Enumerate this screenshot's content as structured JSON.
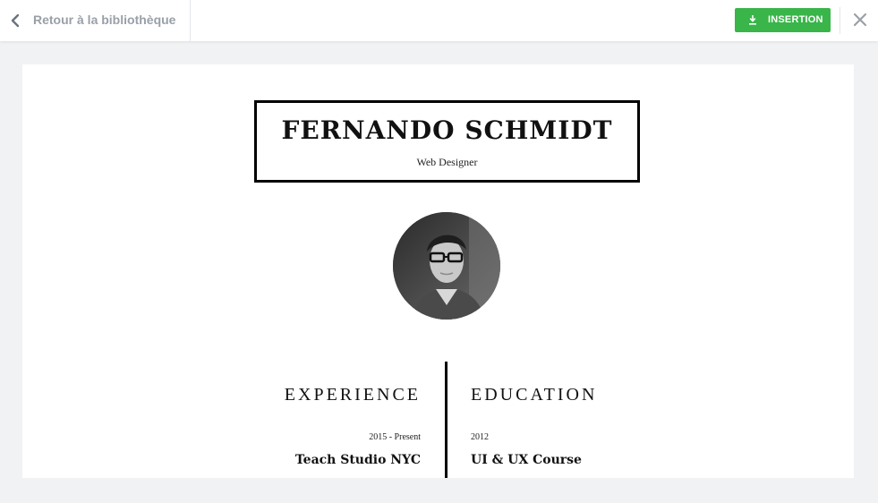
{
  "topbar": {
    "back_label": "Retour à la bibliothèque",
    "insert_label": "INSERTION",
    "accent_color": "#39b54a",
    "icons": [
      "chevron-left-icon",
      "download-icon",
      "close-icon"
    ]
  },
  "resume": {
    "name": "FERNANDO SCHMIDT",
    "role": "Web Designer",
    "experience": {
      "title": "EXPERIENCE",
      "date": "2015 - Present",
      "item": "Teach Studio NYC"
    },
    "education": {
      "title": "EDUCATION",
      "date": "2012",
      "item": "UI & UX Course"
    }
  }
}
